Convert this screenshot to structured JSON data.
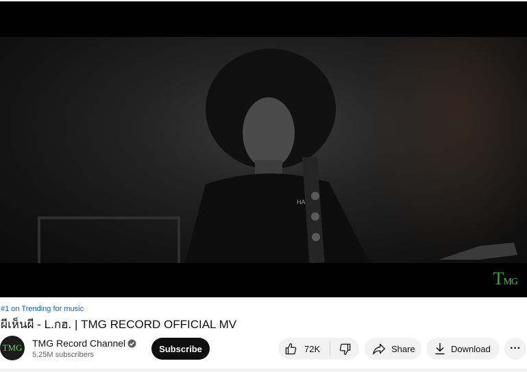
{
  "video": {
    "watermark_main": "T",
    "watermark_small": "MG"
  },
  "trending_label": "#1 on Trending for music",
  "title": "ผีเห็นผี - L.กฮ. | TMG RECORD OFFICIAL MV",
  "channel": {
    "avatar_text": "TMG",
    "name": "TMG Record Channel",
    "subscribers": "5.25M subscribers",
    "subscribe_label": "Subscribe"
  },
  "actions": {
    "likes": "72K",
    "share_label": "Share",
    "download_label": "Download",
    "more_label": "···"
  },
  "icons": [
    "thumbs-up-icon",
    "thumbs-down-icon",
    "share-icon",
    "download-icon",
    "verified-icon",
    "more-icon"
  ]
}
